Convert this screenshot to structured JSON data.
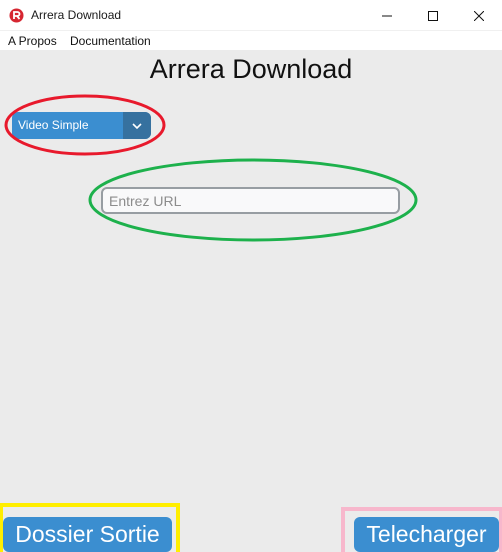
{
  "window": {
    "title": "Arrera Download",
    "controls": [
      "minimize-icon",
      "maximize-icon",
      "close-icon"
    ]
  },
  "menu": {
    "items": [
      "A Propos",
      "Documentation"
    ]
  },
  "main": {
    "title": "Arrera Download",
    "mode_select": {
      "value": "Video Simple"
    },
    "url_input": {
      "placeholder": "Entrez URL",
      "value": ""
    }
  },
  "buttons": {
    "output_folder": "Dossier Sortie",
    "download": "Telecharger"
  },
  "colors": {
    "accent": "#3b8ed0",
    "accent_dark": "#36719f",
    "background": "#ebebeb",
    "annotation_red": "#e8192c",
    "annotation_green": "#1db14c",
    "annotation_yellow": "#ffee00",
    "annotation_pink": "#f7b7cc"
  }
}
